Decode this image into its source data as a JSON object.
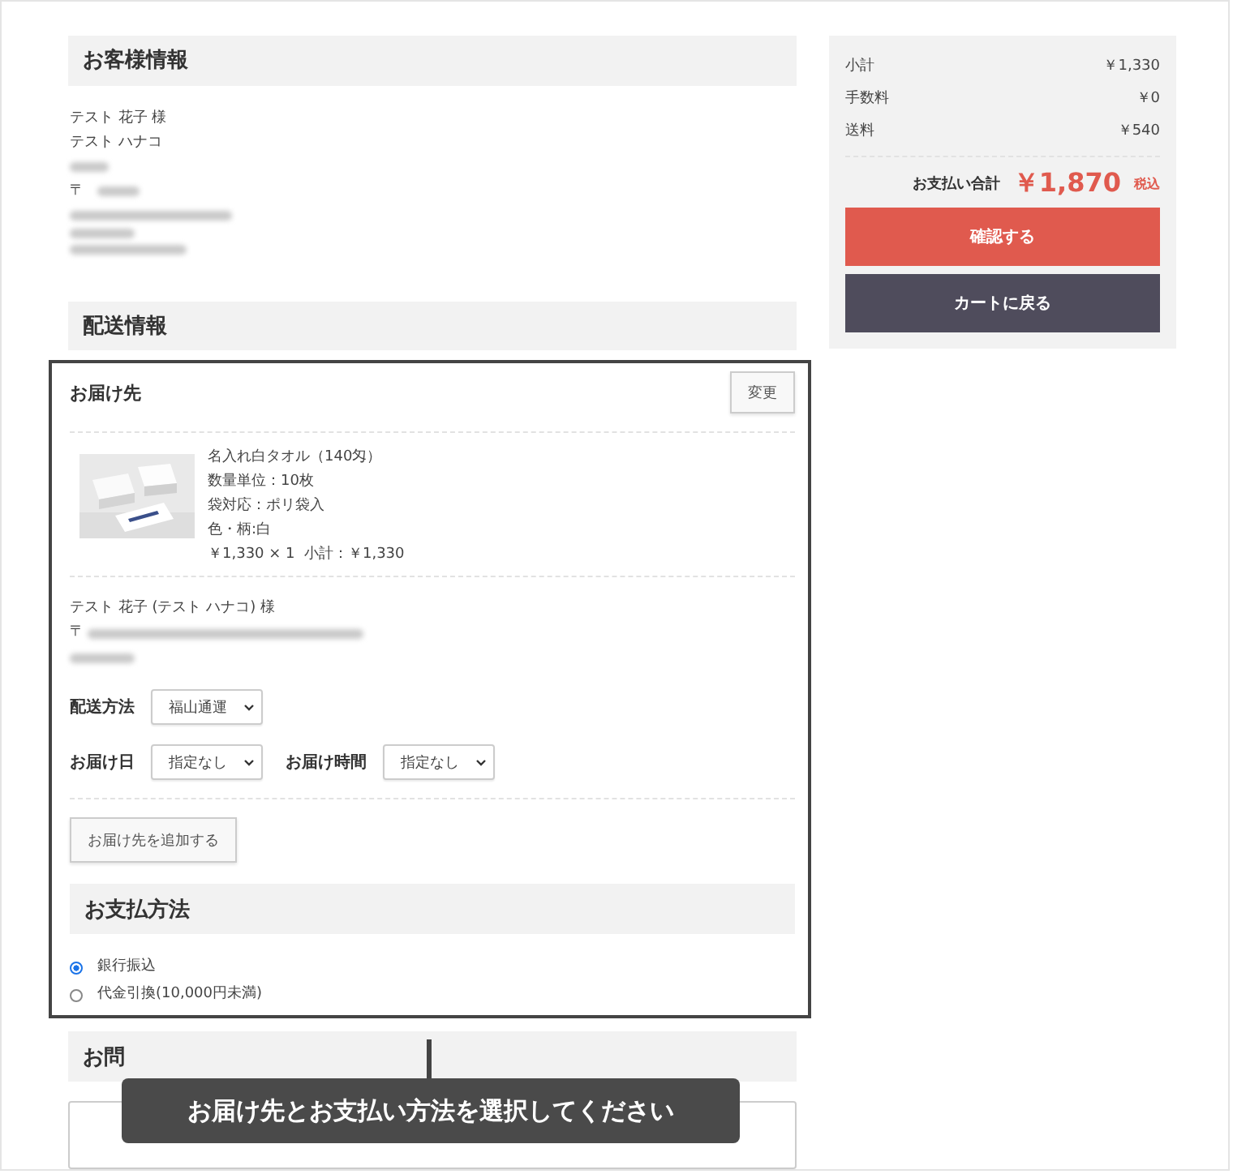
{
  "customer": {
    "heading": "お客様情報",
    "lines": [
      "テスト 花子 様",
      "テスト ハナコ"
    ],
    "postal_mark": "〒"
  },
  "shipping": {
    "heading": "配送情報",
    "destination": {
      "title": "お届け先",
      "change_button": "変更",
      "product": {
        "name": "名入れ白タオル（140匁）",
        "details": [
          "数量単位：10枚",
          "袋対応：ポリ袋入",
          "色・柄:白"
        ],
        "price_line": "￥1,330 × 1  小計：￥1,330"
      },
      "recipient": "テスト 花子 (テスト ハナコ) 様",
      "postal_mark": "〒",
      "fields": [
        {
          "label": "配送方法",
          "value": "福山通運"
        }
      ],
      "date_fields": [
        {
          "label": "お届け日",
          "value": "指定なし"
        },
        {
          "label": "お届け時間",
          "value": "指定なし"
        }
      ]
    },
    "add_button": "お届け先を追加する"
  },
  "payment": {
    "heading": "お支払方法",
    "options": [
      {
        "label": "銀行振込",
        "selected": true
      },
      {
        "label": "代金引換(10,000円未満)",
        "selected": false
      }
    ]
  },
  "inquiry": {
    "heading": "お問"
  },
  "summary": {
    "rows": [
      {
        "label": "小計",
        "value": "￥1,330"
      },
      {
        "label": "手数料",
        "value": "￥0"
      },
      {
        "label": "送料",
        "value": "￥540"
      }
    ],
    "total_label": "お支払い合計",
    "total_value": "￥1,870",
    "tax_note": "税込",
    "buttons": [
      {
        "label": "確認する",
        "kind": "primary"
      },
      {
        "label": "カートに戻る",
        "kind": "secondary"
      }
    ]
  },
  "callout": "お届け先とお支払い方法を選択してください"
}
